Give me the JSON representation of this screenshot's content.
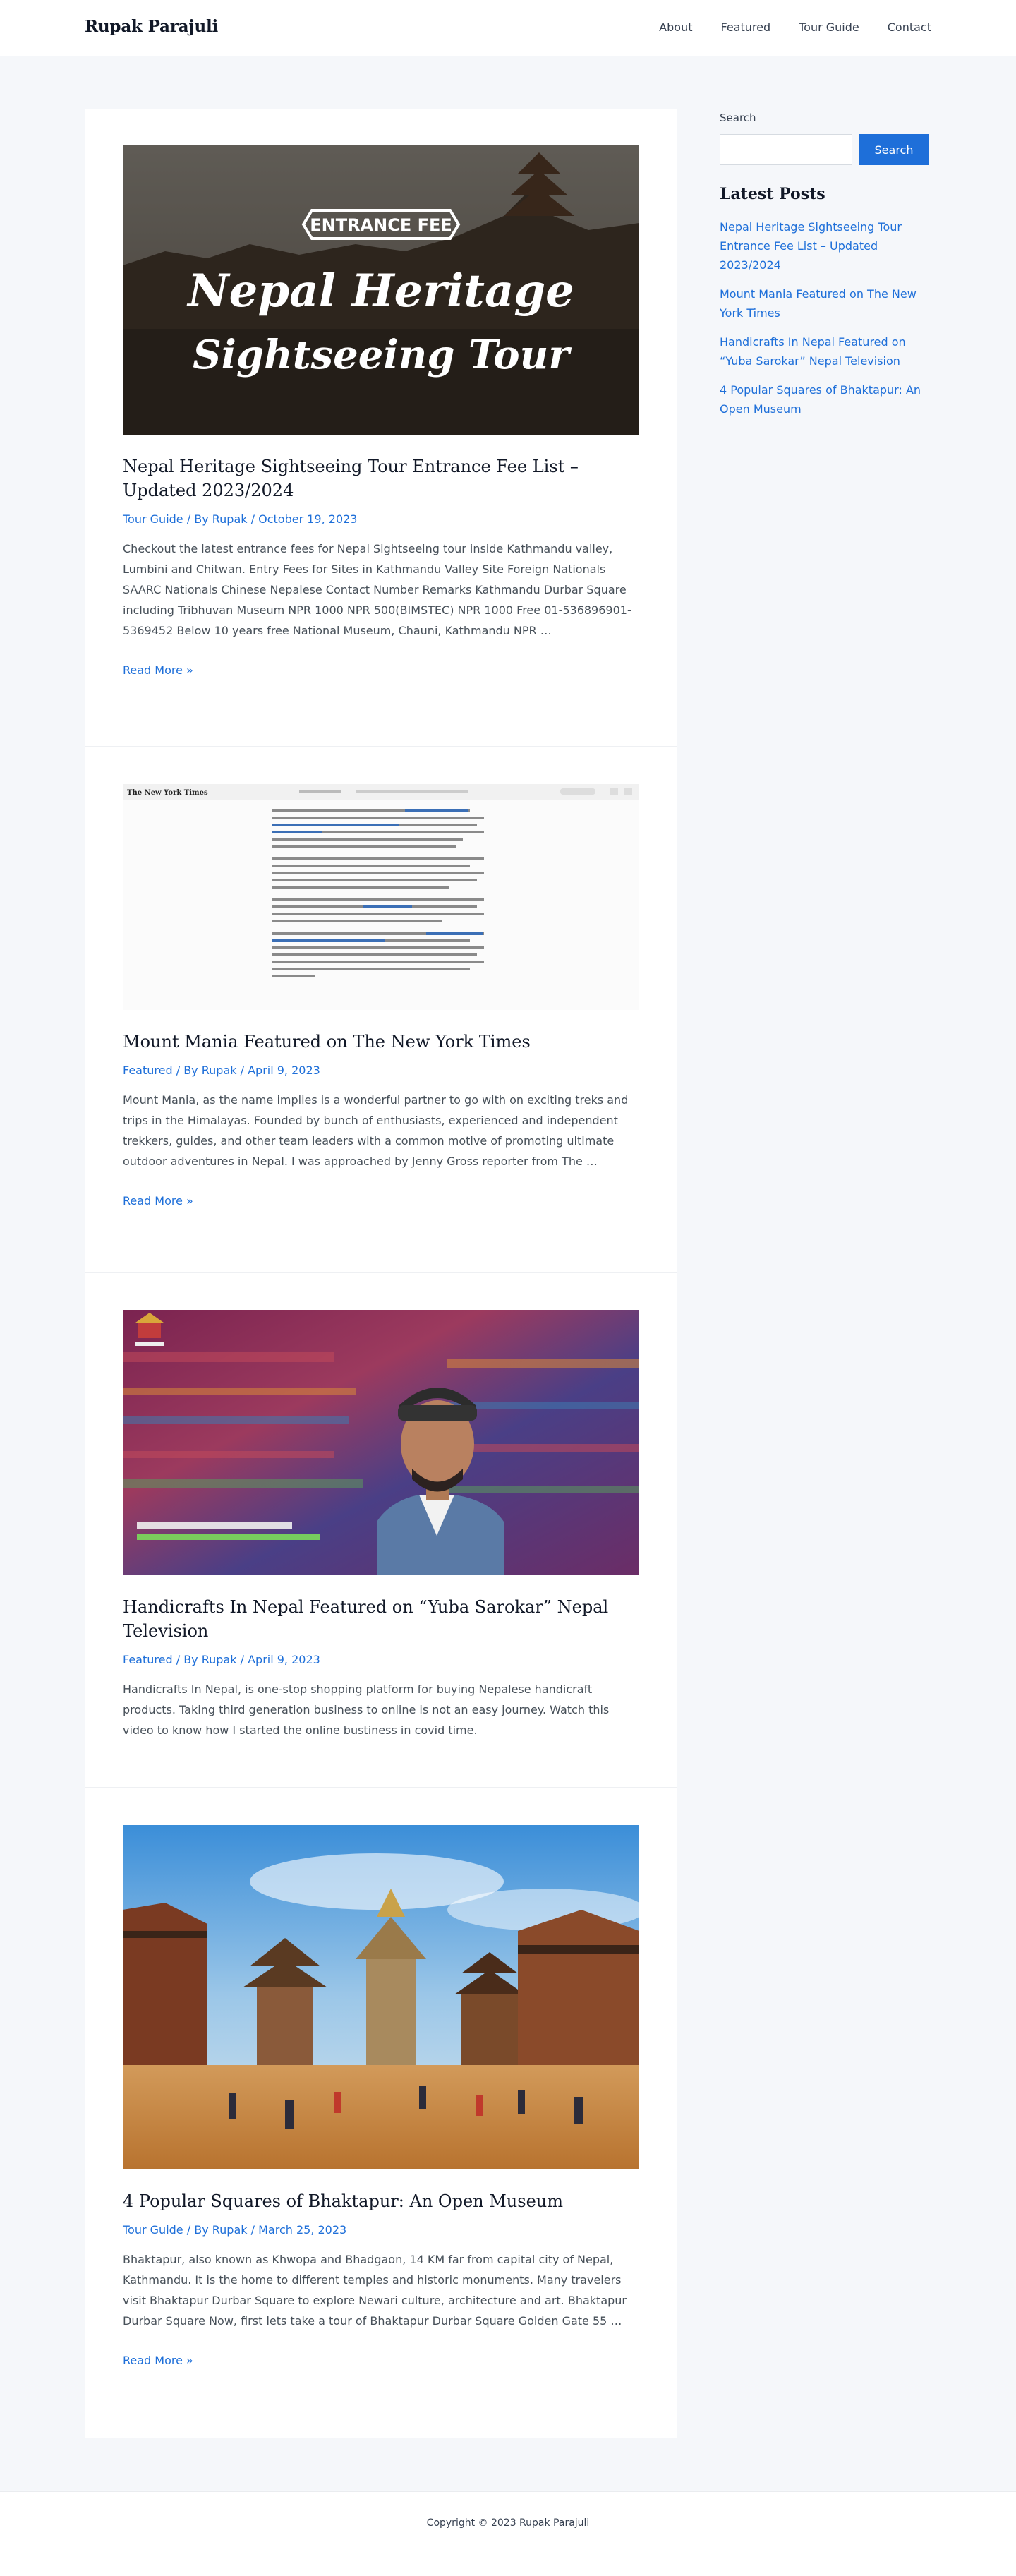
{
  "header": {
    "brand": "Rupak Parajuli",
    "nav": [
      "About",
      "Featured",
      "Tour Guide",
      "Contact"
    ]
  },
  "posts": [
    {
      "title": "Nepal Heritage Sightseeing Tour Entrance Fee List – Updated 2023/2024",
      "category": "Tour Guide",
      "by": "By",
      "author": "Rupak",
      "date": "October 19, 2023",
      "excerpt": "Checkout the latest entrance fees for Nepal Sightseeing tour inside Kathmandu valley, Lumbini and Chitwan. Entry Fees for Sites in Kathmandu Valley Site Foreign Nationals SAARC Nationals Chinese Nepalese Contact Number Remarks Kathmandu Durbar Square including Tribhuvan Museum NPR 1000 NPR 500(BIMSTEC) NPR 1000 Free 01-536896901-5369452 Below 10 years free National Museum, Chauni, Kathmandu NPR …",
      "read_more": "Read More »",
      "image_banner": "ENTRANCE FEE",
      "image_line1": "Nepal Heritage",
      "image_line2": "Sightseeing Tour"
    },
    {
      "title": "Mount Mania Featured on The New York Times",
      "category": "Featured",
      "by": "By",
      "author": "Rupak",
      "date": "April 9, 2023",
      "excerpt": "Mount Mania, as the name implies is a wonderful partner to go with on exciting treks and trips in the Himalayas. Founded by bunch of enthusiasts, experienced and independent trekkers, guides, and other team leaders with a common motive of promoting ultimate outdoor adventures in Nepal. I was approached by Jenny Gross reporter from The …",
      "read_more": "Read More »",
      "image_masthead": "The New York Times"
    },
    {
      "title": "Handicrafts In Nepal Featured on “Yuba Sarokar” Nepal Television",
      "category": "Featured",
      "by": "By",
      "author": "Rupak",
      "date": "April 9, 2023",
      "excerpt": "Handicrafts In Nepal, is one-stop shopping platform for buying Nepalese handicraft products. Taking third generation business to online is not an easy journey. Watch this video to know how I started the online bustiness in covid time."
    },
    {
      "title": "4 Popular Squares of Bhaktapur: An Open Museum",
      "category": "Tour Guide",
      "by": "By",
      "author": "Rupak",
      "date": "March 25, 2023",
      "excerpt": "Bhaktapur, also known as Khwopa and Bhadgaon, 14 KM far from capital city of Nepal, Kathmandu. It is the home to different temples and historic monuments. Many travelers visit Bhaktapur Durbar Square to explore Newari culture, architecture and art. Bhaktapur Durbar Square Now, first lets take a tour of Bhaktapur Durbar Square Golden Gate 55 …",
      "read_more": "Read More »"
    }
  ],
  "sidebar": {
    "search_label": "Search",
    "search_placeholder": "",
    "search_button": "Search",
    "latest_title": "Latest Posts",
    "latest": [
      "Nepal Heritage Sightseeing Tour Entrance Fee List – Updated 2023/2024",
      "Mount Mania Featured on The New York Times",
      "Handicrafts In Nepal Featured on “Yuba Sarokar” Nepal Television",
      "4 Popular Squares of Bhaktapur: An Open Museum"
    ]
  },
  "footer": {
    "copyright": "Copyright © 2023 Rupak Parajuli"
  },
  "colors": {
    "accent": "#1e6fd9",
    "heading": "#111827",
    "page_bg": "#f5f7fa"
  }
}
